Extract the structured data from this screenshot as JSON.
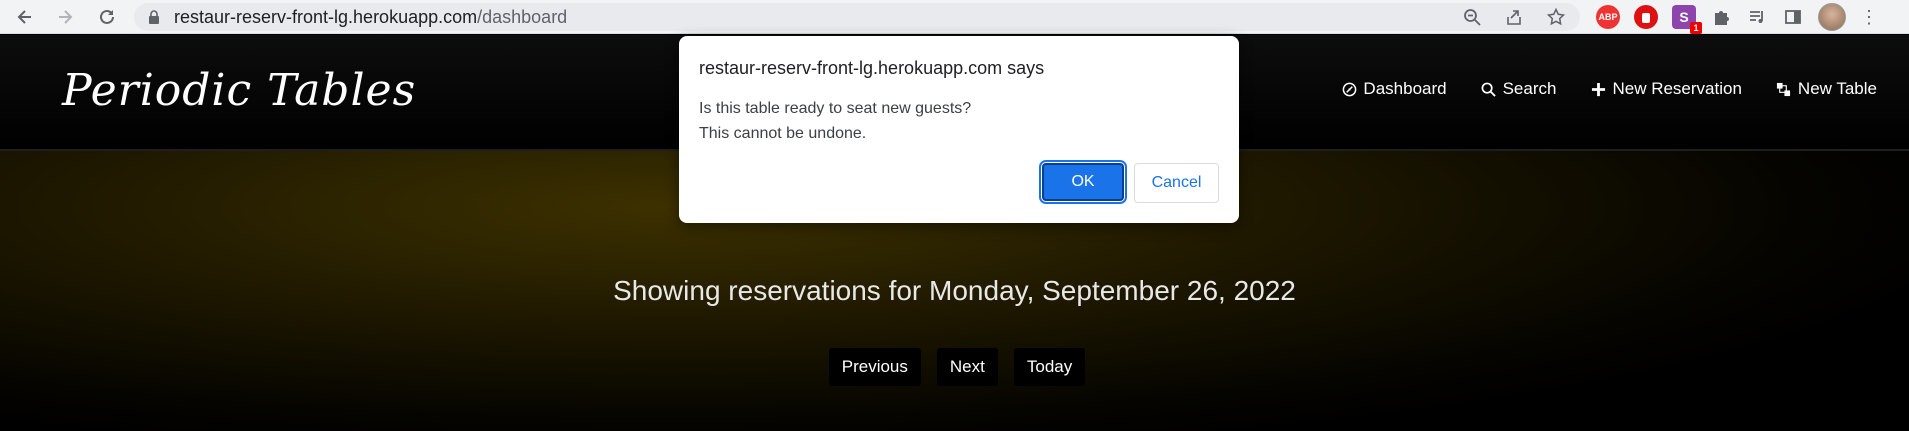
{
  "browser": {
    "url_host": "restaur-reserv-front-lg.herokuapp.com",
    "url_path": "/dashboard"
  },
  "header": {
    "brand": "Periodic Tables",
    "menu": [
      {
        "label": "Dashboard",
        "icon": "dashboard-icon"
      },
      {
        "label": "Search",
        "icon": "search-icon"
      },
      {
        "label": "New Reservation",
        "icon": "plus-icon"
      },
      {
        "label": "New Table",
        "icon": "table-icon"
      }
    ]
  },
  "main": {
    "heading": "Showing reservations for Monday, September 26, 2022",
    "buttons": {
      "previous": "Previous",
      "next": "Next",
      "today": "Today"
    }
  },
  "dialog": {
    "title": "restaur-reserv-front-lg.herokuapp.com says",
    "line1": "Is this table ready to seat new guests?",
    "line2": "This cannot be undone.",
    "ok": "OK",
    "cancel": "Cancel"
  },
  "extensions": {
    "abp_label": "ABP",
    "s_label": "S",
    "s_badge": "1"
  },
  "colors": {
    "accent": "#1a73e8",
    "brand_bg": "#000000",
    "main_glow": "#3d3100"
  }
}
